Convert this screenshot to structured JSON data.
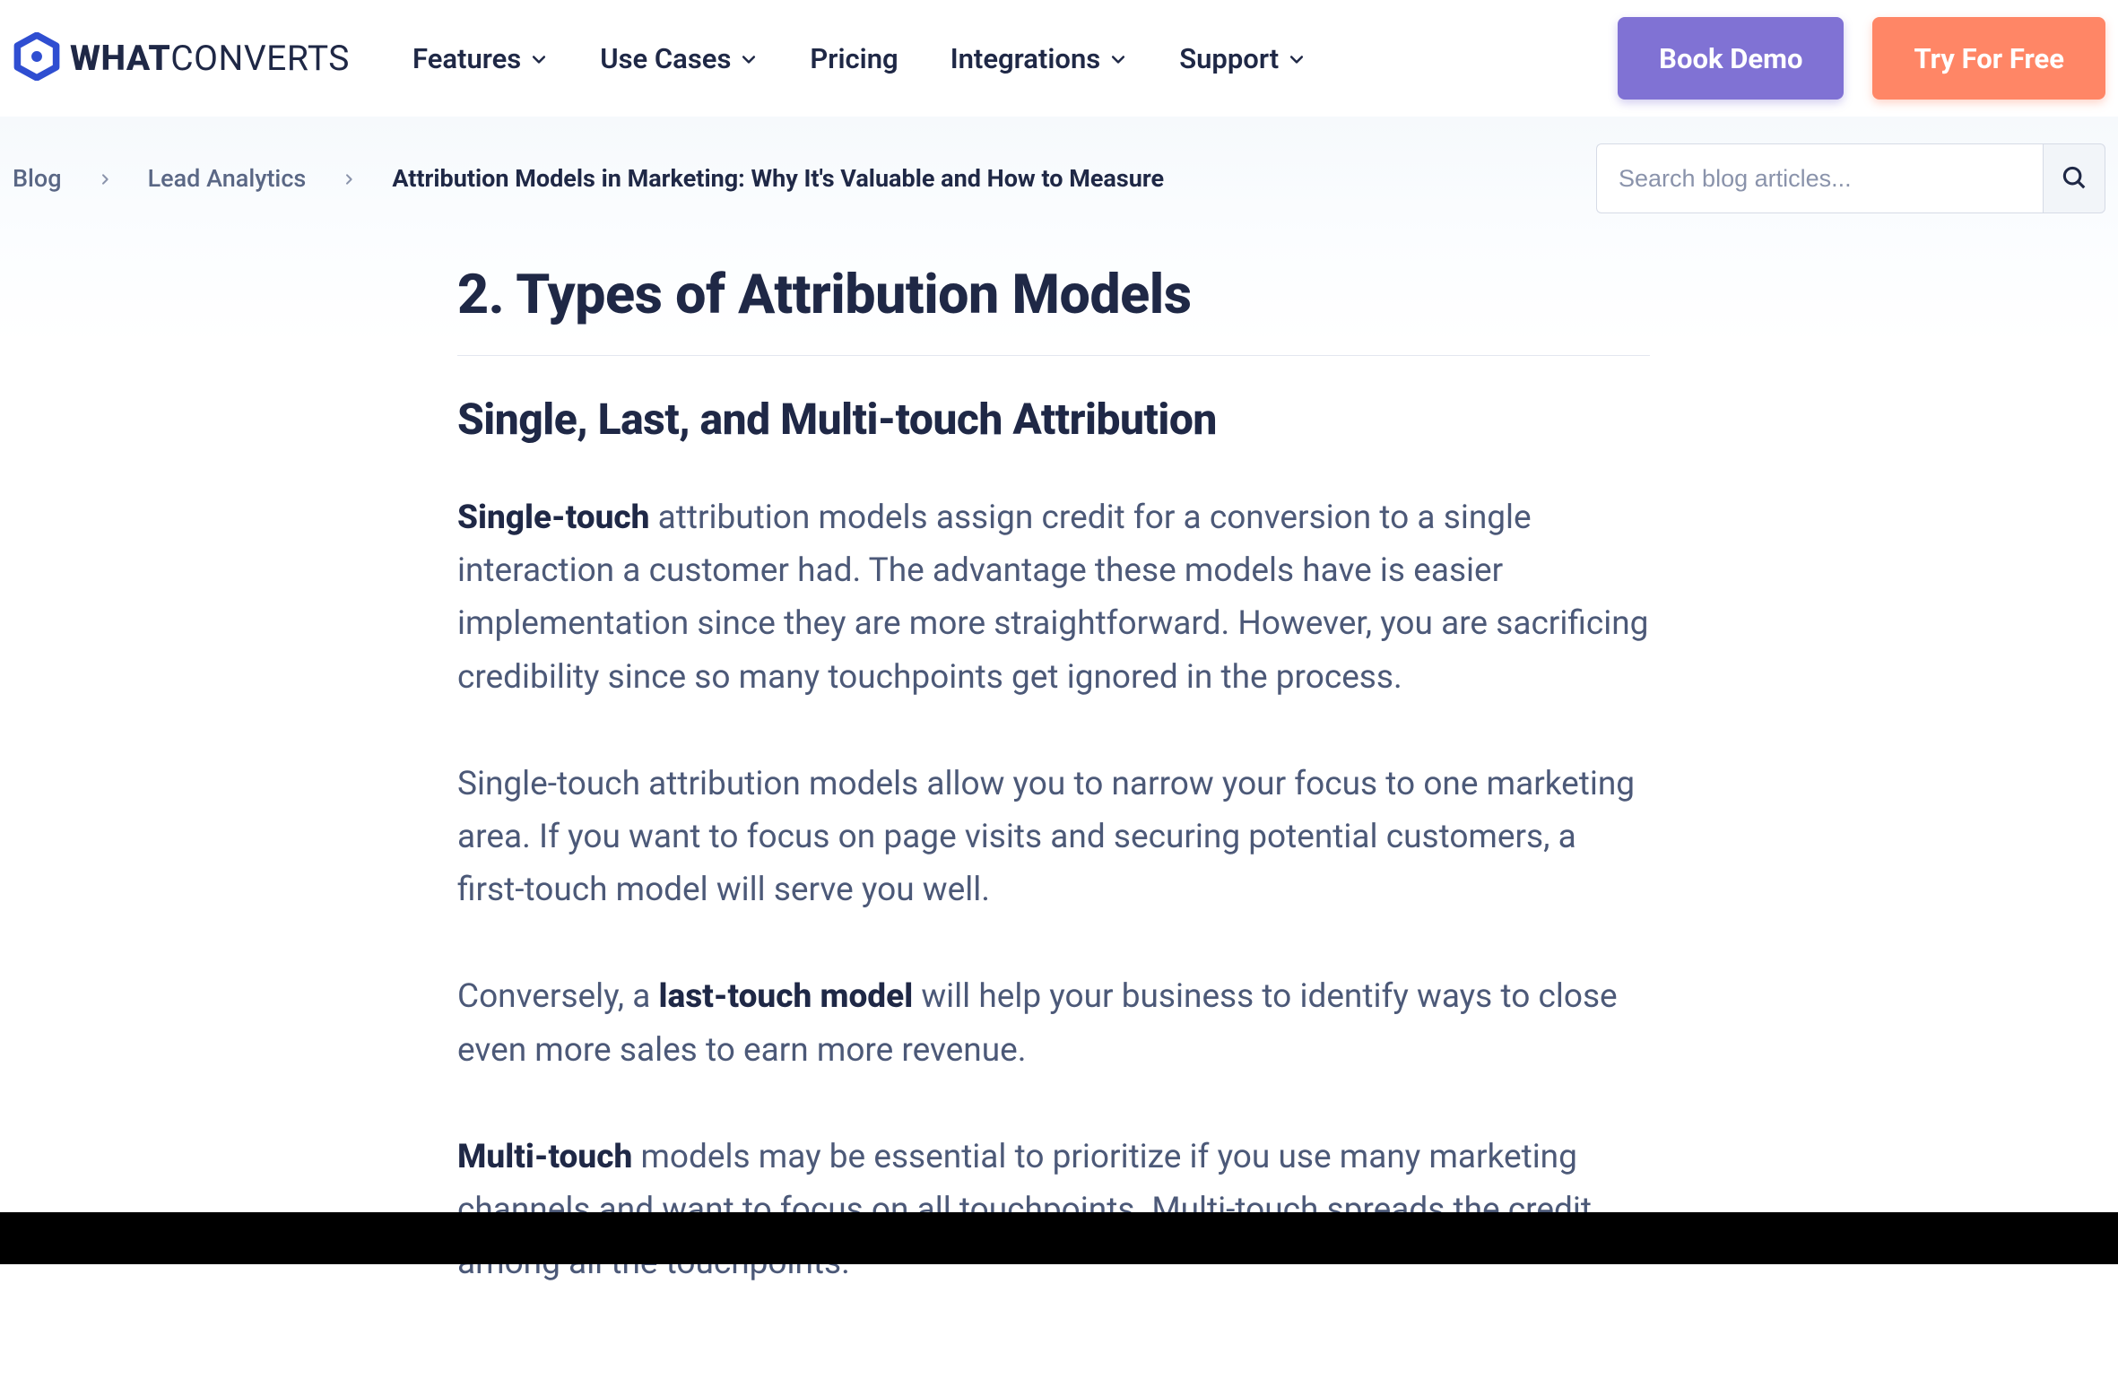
{
  "brand": {
    "bold": "WHAT",
    "light": "CONVERTS"
  },
  "nav": {
    "features": "Features",
    "usecases": "Use Cases",
    "pricing": "Pricing",
    "integrations": "Integrations",
    "support": "Support"
  },
  "cta": {
    "demo": "Book Demo",
    "try": "Try For Free"
  },
  "breadcrumbs": {
    "blog": "Blog",
    "category": "Lead Analytics",
    "current": "Attribution Models in Marketing: Why It's Valuable and How to Measure"
  },
  "search": {
    "placeholder": "Search blog articles..."
  },
  "article": {
    "h2": "2. Types of Attribution Models",
    "h3": "Single, Last, and Multi-touch Attribution",
    "p1_bold": "Single-touch",
    "p1_rest": " attribution models assign credit for a conversion to a single interaction a customer had. The advantage these models have is easier implementation since they are more straightforward. However, you are sacrificing credibility since so many touchpoints get ignored in the process.",
    "p2": "Single-touch attribution models allow you to narrow your focus to one marketing area. If you want to focus on page visits and securing potential customers, a first-touch model will serve you well.",
    "p3_pre": "Conversely, a ",
    "p3_bold": "last-touch model",
    "p3_post": " will help your business to identify ways to close even more sales to earn more revenue.",
    "p4_bold": "Multi-touch",
    "p4_rest": " models may be essential to prioritize if you use many marketing channels and want to focus on all touchpoints. Multi-touch spreads the credit among all the touchpoints."
  }
}
